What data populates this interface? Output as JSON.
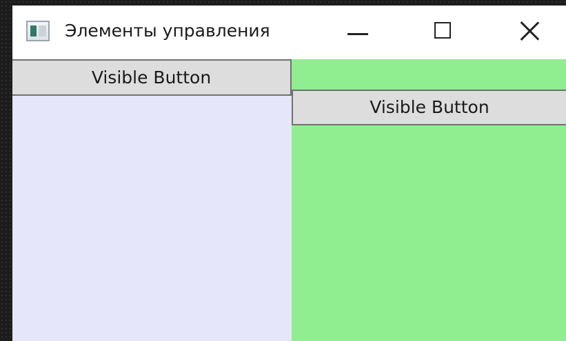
{
  "window": {
    "title": "Элементы управления",
    "icon": "app-window-icon"
  },
  "caption_buttons": {
    "minimize_icon": "minimize-icon",
    "maximize_icon": "maximize-icon",
    "close_icon": "close-icon"
  },
  "panels": {
    "left": {
      "background": "#e6e6fa",
      "button_label": "Visible Button"
    },
    "right": {
      "background": "#90ee90",
      "button_label": "Visible Button"
    }
  }
}
